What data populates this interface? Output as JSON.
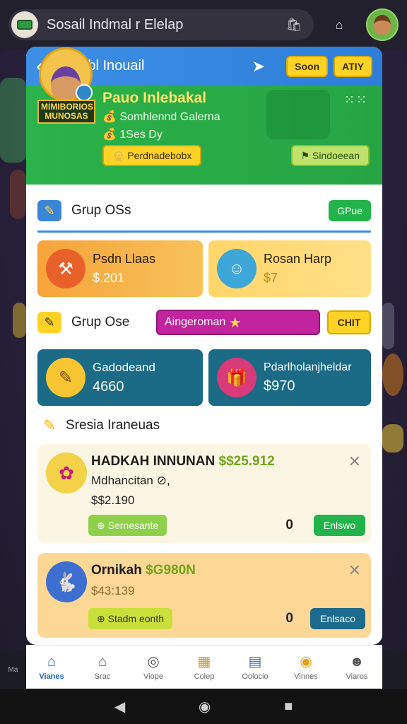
{
  "topbar": {
    "title": "Sosail Indmal r Elelap"
  },
  "header": {
    "title": "Intabl Inouail",
    "btn1": "Soon",
    "btn2": "ATIY"
  },
  "hero": {
    "tag": "MIMIBORIOS MUNOSAS",
    "name": "Pauo Inlebakal",
    "line1": "Somhlennd Galerna",
    "line2": "1Ses Dy",
    "btn": "Perdnadebobx",
    "btn2": "Sindoeean",
    "dots": "⁙⁙"
  },
  "group1": {
    "title": "Grup OSs",
    "button": "GPue",
    "tile1": {
      "name": "Psdn Llaas",
      "value": "$.201"
    },
    "tile2": {
      "name": "Rosan Harp",
      "value": "$7"
    }
  },
  "group2": {
    "title": "Grup Ose",
    "pill": "Aingeroman",
    "button": "CHIT",
    "tile1": {
      "name": "Gadodeand",
      "value": "4660"
    },
    "tile2": {
      "name": "Pdarlholanjheldar",
      "value": "$970"
    }
  },
  "section3": {
    "title": "Sresia Iraneuas"
  },
  "offer1": {
    "title_a": "HADKAH INNUNAN",
    "title_b": "$$25.912",
    "line1": "Mdhancitan ⊘,",
    "line2": "$$2.190",
    "btn": "Sernesante",
    "num": "0",
    "action": "Enlswo"
  },
  "offer2": {
    "title_a": "Ornikah",
    "title_b": "$G980N",
    "line1": "$43:139",
    "btn": "Stadm eonth",
    "num": "0",
    "action": "Enlsaco"
  },
  "nav": [
    {
      "label": "Vianes",
      "icon": "home-icon"
    },
    {
      "label": "Srac",
      "icon": "house-outline-icon"
    },
    {
      "label": "Viope",
      "icon": "camera-icon"
    },
    {
      "label": "Colep",
      "icon": "shop-icon"
    },
    {
      "label": "Oolocio",
      "icon": "calendar-icon"
    },
    {
      "label": "Vinnes",
      "icon": "coins-icon"
    },
    {
      "label": "Viaros",
      "icon": "user-icon"
    }
  ],
  "colors": {
    "header": "#2d7ed8",
    "hero": "#26a444",
    "accent_yellow": "#ffd326",
    "green_btn": "#22b34a",
    "magenta": "#c2249e",
    "teal_tile": "#1a6e8c"
  }
}
